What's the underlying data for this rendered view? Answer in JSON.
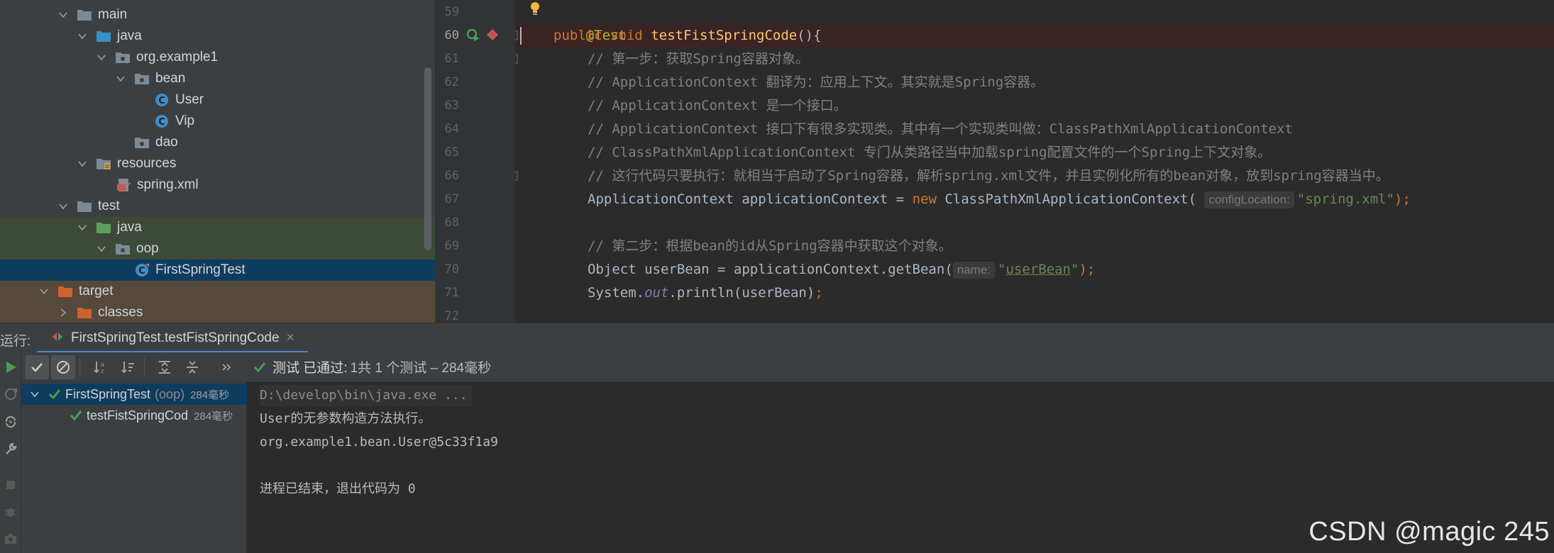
{
  "project_tree": {
    "items": [
      {
        "label": "main",
        "icon": "folder-icon"
      },
      {
        "label": "java",
        "icon": "source-folder-icon"
      },
      {
        "label": "org.example1",
        "icon": "package-icon"
      },
      {
        "label": "bean",
        "icon": "package-icon"
      },
      {
        "label": "User",
        "icon": "class-icon"
      },
      {
        "label": "Vip",
        "icon": "class-icon"
      },
      {
        "label": "dao",
        "icon": "package-icon"
      },
      {
        "label": "resources",
        "icon": "resources-folder-icon"
      },
      {
        "label": "spring.xml",
        "icon": "xml-file-icon"
      },
      {
        "label": "test",
        "icon": "folder-icon"
      },
      {
        "label": "java",
        "icon": "test-source-folder-icon"
      },
      {
        "label": "oop",
        "icon": "package-icon"
      },
      {
        "label": "FirstSpringTest",
        "icon": "test-class-icon"
      },
      {
        "label": "target",
        "icon": "excluded-folder-icon"
      },
      {
        "label": "classes",
        "icon": "excluded-folder-icon"
      }
    ]
  },
  "editor": {
    "line_numbers": [
      "59",
      "60",
      "61",
      "62",
      "63",
      "64",
      "65",
      "66",
      "67",
      "68",
      "69",
      "70",
      "71",
      "72"
    ],
    "line59": {
      "annotation": "@Test"
    },
    "line60": {
      "kw1": "public",
      "kw2": "void",
      "method": "testFistSpringCode",
      "tail": "(){"
    },
    "comments": {
      "l61": "// 第一步：获取Spring容器对象。",
      "l62": "// ApplicationContext 翻译为：应用上下文。其实就是Spring容器。",
      "l63": "// ApplicationContext 是一个接口。",
      "l64": "// ApplicationContext 接口下有很多实现类。其中有一个实现类叫做：ClassPathXmlApplicationContext",
      "l65": "// ClassPathXmlApplicationContext 专门从类路径当中加载spring配置文件的一个Spring上下文对象。",
      "l66": "// 这行代码只要执行：就相当于启动了Spring容器，解析spring.xml文件，并且实例化所有的bean对象，放到spring容器当中。",
      "l69": "// 第二步：根据bean的id从Spring容器中获取这个对象。"
    },
    "line67": {
      "pre": "ApplicationContext applicationContext = ",
      "kw_new": "new",
      "ctor": " ClassPathXmlApplicationContext(",
      "hint": "configLocation:",
      "str": "\"spring.xml\"",
      "tail": ");"
    },
    "line70": {
      "pre": "Object userBean = applicationContext.getBean(",
      "hint": "name:",
      "q1": "\"",
      "str": "userBean",
      "q2": "\"",
      "tail": ");"
    },
    "line71": {
      "pre": "System.",
      "static": "out",
      "mid": ".println(userBean)",
      "tail": ";"
    }
  },
  "run_panel": {
    "label": "运行:",
    "tab_title": "FirstSpringTest.testFistSpringCode",
    "tab_close": "×",
    "status_passed": "测试 已通过:",
    "status_detail": "1共 1 个测试 – 284毫秒",
    "test_tree": [
      {
        "name": "FirstSpringTest",
        "sub": "(oop)",
        "time": "284毫秒"
      },
      {
        "name": "testFistSpringCod",
        "sub": "",
        "time": "284毫秒"
      }
    ],
    "console": [
      "D:\\develop\\bin\\java.exe ...",
      "User的无参数构造方法执行。",
      "org.example1.bean.User@5c33f1a9",
      "",
      "进程已结束，退出代码为 0"
    ]
  },
  "watermark": "CSDN @magic 245",
  "colors": {
    "accent_blue": "#4a88c7",
    "pass_green": "#499c54",
    "keyword": "#cc7832",
    "method": "#ffc66d",
    "string": "#6a8759",
    "comment": "#808080",
    "annotation": "#bbb529"
  }
}
